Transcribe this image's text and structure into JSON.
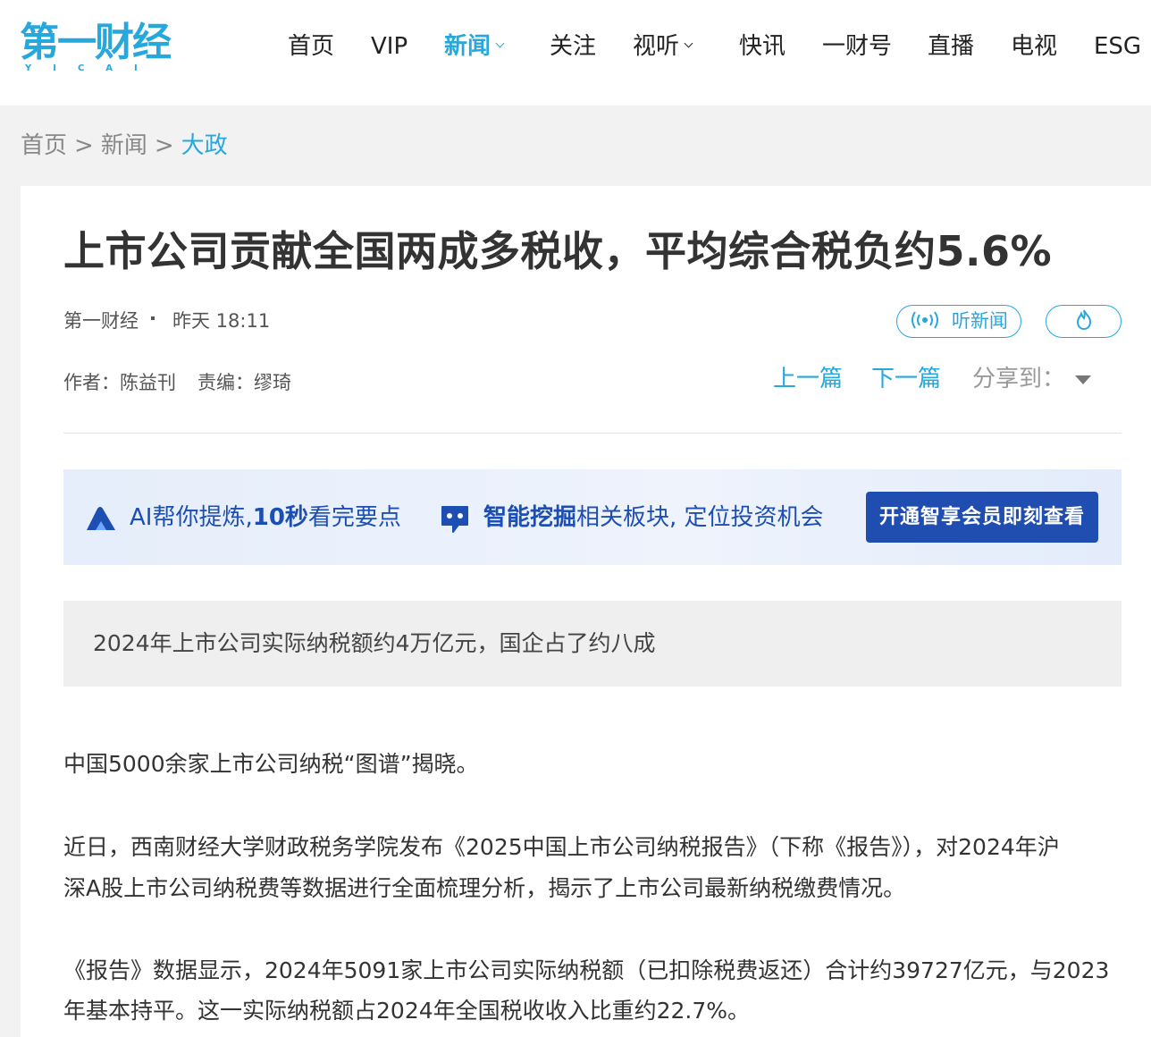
{
  "header": {
    "logo": {
      "main": "第一财经",
      "sub": "YICAI"
    },
    "nav": [
      {
        "label": "首页"
      },
      {
        "label": "VIP"
      },
      {
        "label": "新闻"
      },
      {
        "label": "关注"
      },
      {
        "label": "视听"
      },
      {
        "label": "快讯"
      },
      {
        "label": "一财号"
      },
      {
        "label": "直播"
      },
      {
        "label": "电视"
      },
      {
        "label": "ESG"
      }
    ]
  },
  "breadcrumb": {
    "home": "首页",
    "news": "新闻",
    "current": "大政",
    "sep": ">"
  },
  "article": {
    "title": "上市公司贡献全国两成多税收，平均综合税负约5.6%",
    "source": "第一财经",
    "time": "昨天 18:11",
    "listen_label": "听新闻",
    "author_line": "作者：陈益刊",
    "editor_line": "责编：缪琦",
    "prev_label": "上一篇",
    "next_label": "下一篇",
    "share_label": "分享到："
  },
  "ai_banner": {
    "seg1_pre": "AI帮你提炼,",
    "seg1_bold": "10秒",
    "seg1_post": "看完要点",
    "seg2_bold": "智能挖掘",
    "seg2_post": "相关板块, 定位投资机会",
    "button_label": "开通智享会员即刻查看"
  },
  "summary": "2024年上市公司实际纳税额约4万亿元，国企占了约八成",
  "paragraphs": {
    "p1": "中国5000余家上市公司纳税“图谱”揭晓。",
    "p2_l1": "近日，西南财经大学财政税务学院发布《2025中国上市公司纳税报告》（下称《报告》），对2024年沪",
    "p2_l2": "深A股上市公司纳税费等数据进行全面梳理分析，揭示了上市公司最新纳税缴费情况。",
    "p3_l1": "《报告》数据显示，2024年5091家上市公司实际纳税额（已扣除税费返还）合计约39727亿元，与2023",
    "p3_l2": "年基本持平。这一实际纳税额占2024年全国税收收入比重约22.7%。"
  },
  "colors": {
    "accent": "#27a8dd",
    "ai_blue": "#1d4fb3",
    "ai_button": "#1f4eb0"
  }
}
